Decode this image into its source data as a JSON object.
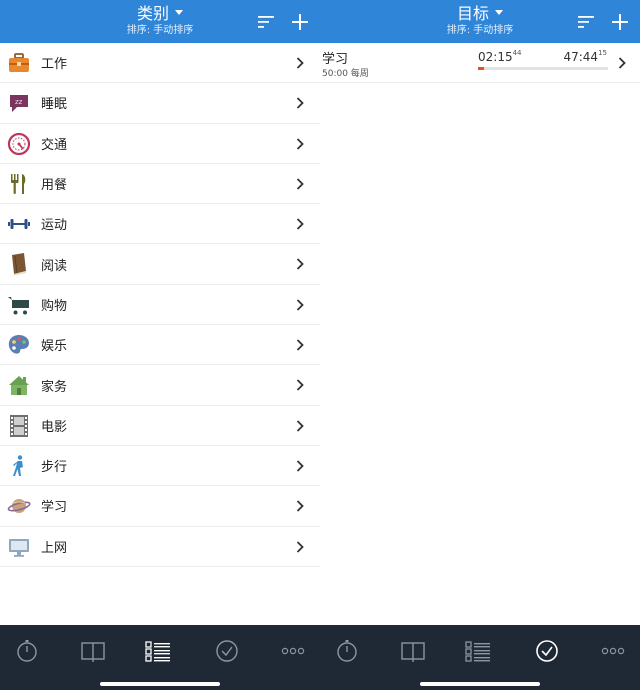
{
  "categories_panel": {
    "header": {
      "title": "类别",
      "subtitle": "排序: 手动排序"
    },
    "items": [
      {
        "label": "工作",
        "icon": "briefcase-icon"
      },
      {
        "label": "睡眠",
        "icon": "sleep-bubble-icon"
      },
      {
        "label": "交通",
        "icon": "speedometer-icon"
      },
      {
        "label": "用餐",
        "icon": "fork-knife-icon"
      },
      {
        "label": "运动",
        "icon": "dumbbell-icon"
      },
      {
        "label": "阅读",
        "icon": "book-icon"
      },
      {
        "label": "购物",
        "icon": "shopping-cart-icon"
      },
      {
        "label": "娱乐",
        "icon": "palette-icon"
      },
      {
        "label": "家务",
        "icon": "house-icon"
      },
      {
        "label": "电影",
        "icon": "film-strip-icon"
      },
      {
        "label": "步行",
        "icon": "walking-person-icon"
      },
      {
        "label": "学习",
        "icon": "planet-icon"
      },
      {
        "label": "上网",
        "icon": "monitor-icon"
      }
    ]
  },
  "goals_panel": {
    "header": {
      "title": "目标",
      "subtitle": "排序: 手动排序"
    },
    "goal": {
      "name": "学习",
      "target": "50:00 每周",
      "elapsed_main": "02:15",
      "elapsed_sec": "44",
      "remaining_main": "47:44",
      "remaining_sec": "15",
      "progress_fraction": 0.045
    }
  },
  "tabbar": {
    "tabs": [
      "timer-tab",
      "history-tab",
      "categories-tab",
      "goals-tab",
      "more-tab"
    ],
    "left_active": "categories-tab",
    "right_active": "goals-tab"
  },
  "colors": {
    "header": "#2f85d8",
    "tabbar": "#1f2835",
    "progress": "#e3502c"
  }
}
